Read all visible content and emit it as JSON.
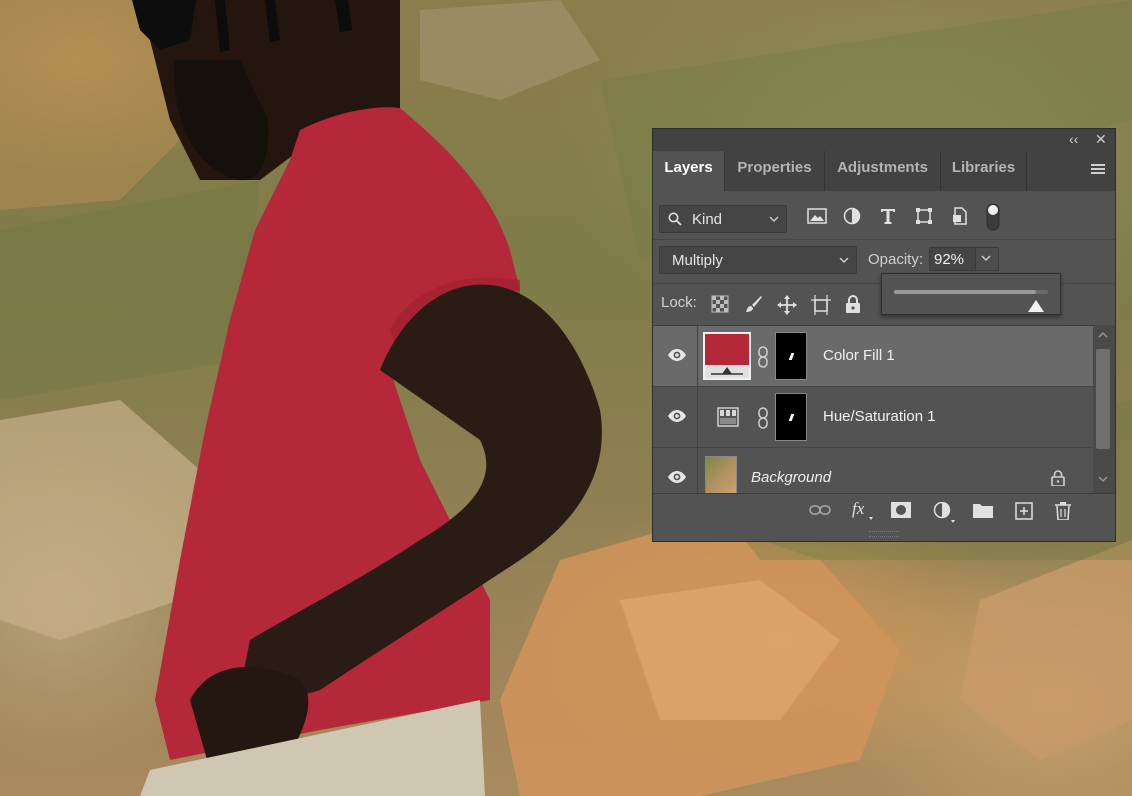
{
  "window": {
    "collapse_icon": "double-chevron-left-icon",
    "close_icon": "close-icon"
  },
  "tabs": [
    {
      "label": "Layers",
      "active": true
    },
    {
      "label": "Properties",
      "active": false
    },
    {
      "label": "Adjustments",
      "active": false
    },
    {
      "label": "Libraries",
      "active": false
    }
  ],
  "filter": {
    "kind_label": "Kind",
    "icons": [
      "image-filter-icon",
      "adjustment-filter-icon",
      "type-filter-icon",
      "shape-filter-icon",
      "smart-object-filter-icon",
      "filter-toggle-icon"
    ]
  },
  "blend": {
    "mode": "Multiply",
    "opacity_label": "Opacity:",
    "opacity_value": "92%",
    "slider_level": 0.92
  },
  "lock": {
    "label": "Lock:",
    "icons": [
      "lock-transparent-pixels-icon",
      "lock-image-pixels-icon",
      "lock-position-icon",
      "lock-artboard-icon",
      "lock-all-icon"
    ]
  },
  "layers": [
    {
      "name": "Color Fill 1",
      "selected": true,
      "visible": true,
      "fill_color": "#b5283a"
    },
    {
      "name": "Hue/Saturation 1",
      "selected": false,
      "visible": true
    },
    {
      "name": "Background",
      "selected": false,
      "visible": true,
      "locked": true
    }
  ],
  "footer_icons": [
    "link-layers-icon",
    "fx-icon",
    "add-mask-icon",
    "new-adjustment-layer-icon",
    "new-group-icon",
    "new-layer-icon",
    "delete-icon"
  ],
  "colors": {
    "panel_bg": "#535353",
    "shirt": "#b5283a"
  }
}
